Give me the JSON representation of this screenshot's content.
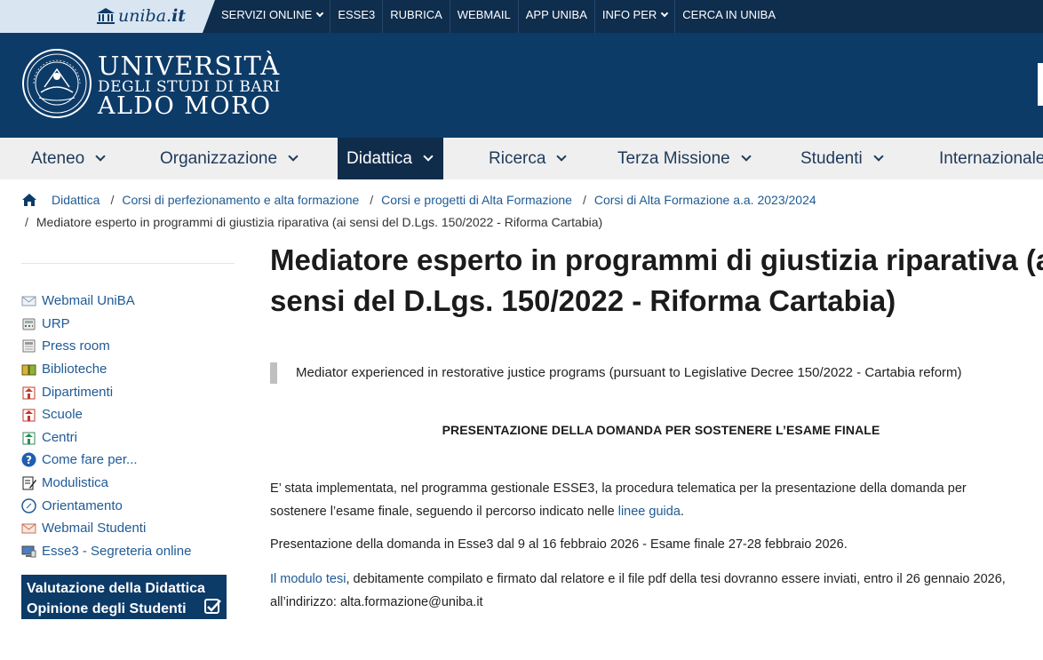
{
  "topbar": {
    "brand_plain": "uniba.",
    "brand_bold": "it",
    "items": [
      {
        "label": "SERVIZI ONLINE",
        "has_menu": true
      },
      {
        "label": "ESSE3",
        "has_menu": false
      },
      {
        "label": "RUBRICA",
        "has_menu": false
      },
      {
        "label": "WEBMAIL",
        "has_menu": false
      },
      {
        "label": "APP UNIBA",
        "has_menu": false
      },
      {
        "label": "INFO PER",
        "has_menu": true
      },
      {
        "label": "CERCA IN UNIBA",
        "has_menu": false
      }
    ]
  },
  "header": {
    "line1": "UNIVERSITÀ",
    "line2": "DEGLI STUDI DI BARI",
    "line3": "ALDO MORO"
  },
  "mainnav": {
    "items": [
      "Ateneo",
      "Organizzazione",
      "Didattica",
      "Ricerca",
      "Terza Missione",
      "Studenti",
      "Internazionale"
    ],
    "active": "Didattica"
  },
  "breadcrumb": {
    "items": [
      "Didattica",
      "Corsi di perfezionamento e alta formazione",
      "Corsi e progetti di Alta Formazione",
      "Corsi di Alta Formazione a.a. 2023/2024"
    ],
    "current": "Mediatore esperto in programmi di giustizia riparativa (ai sensi del D.Lgs. 150/2022 - Riforma Cartabia)"
  },
  "sidebar": {
    "links": [
      {
        "label": "Webmail UniBA",
        "icon": "envelope-icon"
      },
      {
        "label": "URP",
        "icon": "phone-icon"
      },
      {
        "label": "Press room",
        "icon": "newspaper-icon"
      },
      {
        "label": "Biblioteche",
        "icon": "book-icon"
      },
      {
        "label": "Dipartimenti",
        "icon": "building-icon"
      },
      {
        "label": "Scuole",
        "icon": "school-icon"
      },
      {
        "label": "Centri",
        "icon": "center-icon"
      },
      {
        "label": "Come fare per...",
        "icon": "help-icon"
      },
      {
        "label": "Modulistica",
        "icon": "form-icon"
      },
      {
        "label": "Orientamento",
        "icon": "compass-icon"
      },
      {
        "label": "Webmail Studenti",
        "icon": "mail-icon"
      },
      {
        "label": "Esse3 - Segreteria online",
        "icon": "monitor-icon"
      }
    ],
    "banner_line1": "Valutazione della Didattica",
    "banner_line2": "Opinione degli Studenti"
  },
  "content": {
    "title_line1": "Mediatore esperto in programmi di giustizia riparativa (ai",
    "title_line2": "sensi del D.Lgs. 150/2022 - Riforma Cartabia)",
    "quote": "Mediator experienced in restorative justice programs (pursuant to Legislative Decree 150/2022 - Cartabia reform)",
    "subheading": "PRESENTAZIONE DELLA DOMANDA PER SOSTENERE L’ESAME FINALE",
    "p1_line1": "E’ stata implementata, nel programma gestionale ESSE3, la procedura telematica per la presentazione della domanda per",
    "p1_line2_pre": "sostenere l’esame finale, seguendo il percorso indicato nelle ",
    "p1_link": "linee guida",
    "p1_line2_post": ".",
    "p2": "Presentazione della domanda in Esse3 dal 9 al 16 febbraio 2026 - Esame finale 27-28 febbraio 2026.",
    "p3_link": "Il modulo tesi",
    "p3_line1_post": ", debitamente compilato e firmato dal relatore e il file pdf della tesi dovranno essere inviati, entro il 26 gennaio 2026,",
    "p3_line2": "all’indirizzo: alta.formazione@uniba.it"
  },
  "colors": {
    "topbar": "#0f2d4d",
    "header": "#0d3b68",
    "nav_active": "#102c4b",
    "link": "#205b94"
  }
}
